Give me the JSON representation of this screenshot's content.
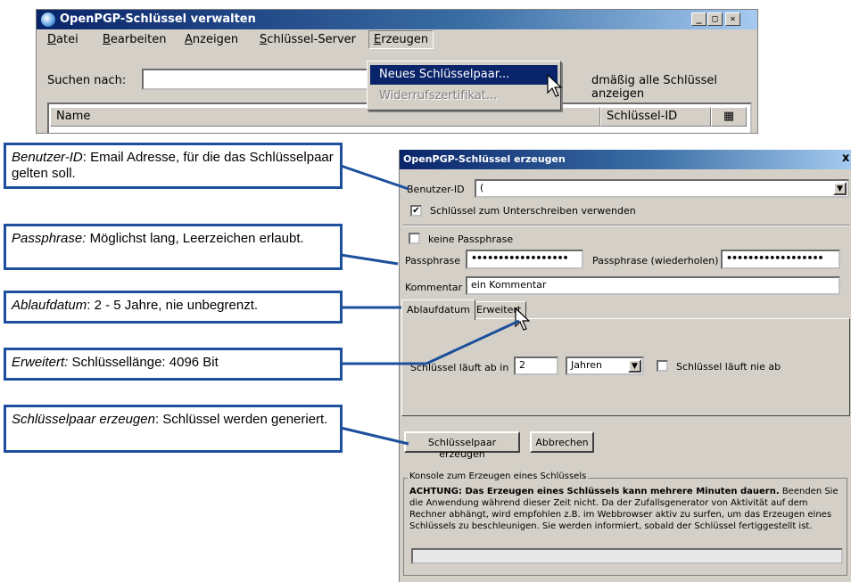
{
  "main_window": {
    "title": "OpenPGP-Schlüssel verwalten",
    "buttons": {
      "minimize": "_",
      "maximize": "□",
      "close": "✕"
    },
    "menu": [
      "Datei",
      "Bearbeiten",
      "Anzeigen",
      "Schlüssel-Server",
      "Erzeugen"
    ],
    "search_label": "Suchen nach:",
    "search_value": "",
    "show_all_partial": "dmäßig alle Schlüssel anzeigen",
    "columns": {
      "name": "Name",
      "key_id": "Schlüssel-ID"
    },
    "dropdown": {
      "items": [
        "Neues Schlüsselpaar...",
        "Widerrufszertifikat..."
      ]
    }
  },
  "dialog": {
    "title": "OpenPGP-Schlüssel erzeugen",
    "close": "x",
    "user_id_label": "Benutzer-ID",
    "user_id_value": "(",
    "sign_checkbox": "Schlüssel zum Unterschreiben verwenden",
    "no_passphrase": "keine Passphrase",
    "passphrase_label": "Passphrase",
    "passphrase_value": "••••••••••••••••••",
    "passphrase_repeat_label": "Passphrase (wiederholen)",
    "passphrase_repeat_value": "••••••••••••••••••",
    "comment_label": "Kommentar",
    "comment_value": "ein Kommentar",
    "tabs": [
      "Ablaufdatum",
      "Erweitert"
    ],
    "expiry_label": "Schlüssel läuft ab in",
    "expiry_value": "2",
    "expiry_unit": "Jahren",
    "never_expires": "Schlüssel läuft nie ab",
    "generate_button": "Schlüsselpaar erzeugen",
    "cancel_button": "Abbrechen",
    "console_title": "Konsole zum Erzeugen eines Schlüssels",
    "console_bold": "ACHTUNG: Das Erzeugen eines Schlüssels kann mehrere Minuten dauern.",
    "console_text": " Beenden Sie die Anwendung während dieser Zeit nicht. Da der Zufallsgenerator von Aktivität auf dem Rechner abhängt, wird empfohlen z.B. im Webbrowser aktiv zu surfen, um das Erzeugen eines Schlüssels zu beschleunigen. Sie werden informiert, sobald der Schlüssel fertiggestellt ist."
  },
  "callouts": [
    {
      "term": "Benutzer-ID",
      "sep": ": ",
      "text": "Email Adresse, für die das Schlüsselpaar gelten soll."
    },
    {
      "term": "Passphrase:",
      "sep": " ",
      "text": "Möglichst lang, Leerzeichen erlaubt."
    },
    {
      "term": "Ablaufdatum",
      "sep": ": ",
      "text": "2 - 5 Jahre, nie unbegrenzt."
    },
    {
      "term": "Erweitert:",
      "sep": " ",
      "text": "Schlüssellänge: 4096 Bit"
    },
    {
      "term": "Schlüsselpaar erzeugen",
      "sep": ": ",
      "text": "Schlüssel werden generiert."
    }
  ],
  "colors": {
    "callout_border": "#1c4f9c",
    "titlebar": "#0a246a",
    "window_bg": "#d4d0c8"
  }
}
